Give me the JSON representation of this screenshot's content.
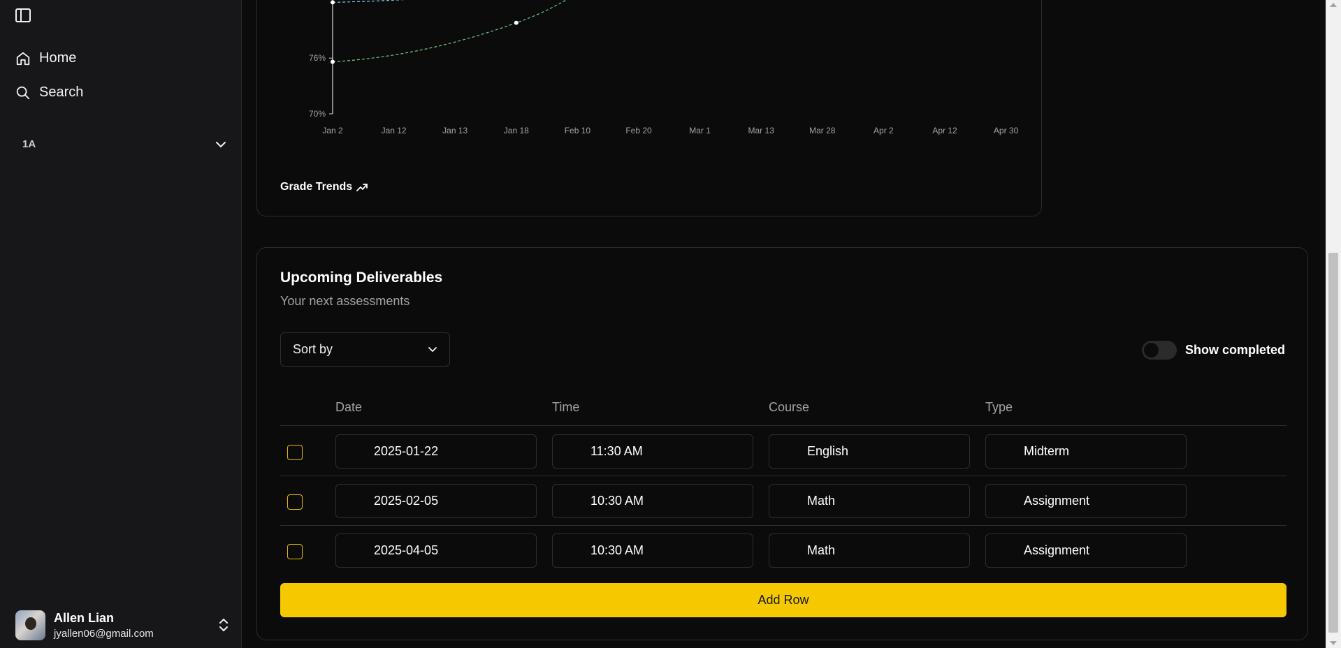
{
  "sidebar": {
    "nav": [
      {
        "label": "Home",
        "icon": "home-icon"
      },
      {
        "label": "Search",
        "icon": "search-icon"
      }
    ],
    "group_label": "1A",
    "user": {
      "name": "Allen Lian",
      "email": "jyallen06@gmail.com"
    }
  },
  "chart": {
    "title": "Grade Trends",
    "chart_data": {
      "type": "line",
      "x_labels": [
        "Jan 2",
        "Jan 12",
        "Jan 13",
        "Jan 18",
        "Feb 10",
        "Feb 20",
        "Mar 1",
        "Mar 13",
        "Mar 28",
        "Apr 2",
        "Apr 12",
        "Apr 30"
      ],
      "y_ticks": [
        "70%",
        "76%"
      ],
      "y_ticks_values": [
        70,
        76
      ],
      "series": [
        {
          "color": "#7fd3e0",
          "points": [
            {
              "x": "Jan 2",
              "y": 82
            }
          ]
        },
        {
          "color": "#6fd18a",
          "points": [
            {
              "x": "Jan 2",
              "y": 75.6
            },
            {
              "x": "Jan 18",
              "y": 79.8
            }
          ]
        }
      ],
      "grid": false,
      "legend": "none"
    }
  },
  "deliverables": {
    "title": "Upcoming Deliverables",
    "subtitle": "Your next assessments",
    "sort_label": "Sort by",
    "toggle_label": "Show completed",
    "columns": [
      "Date",
      "Time",
      "Course",
      "Type"
    ],
    "rows": [
      {
        "date": "2025-01-22",
        "time": "11:30 AM",
        "course": "English",
        "type": "Midterm"
      },
      {
        "date": "2025-02-05",
        "time": "10:30 AM",
        "course": "Math",
        "type": "Assignment"
      },
      {
        "date": "2025-04-05",
        "time": "10:30 AM",
        "course": "Math",
        "type": "Assignment"
      }
    ],
    "add_row_label": "Add Row"
  },
  "colors": {
    "accent": "#f5c800",
    "checkbox": "#e6b800"
  }
}
